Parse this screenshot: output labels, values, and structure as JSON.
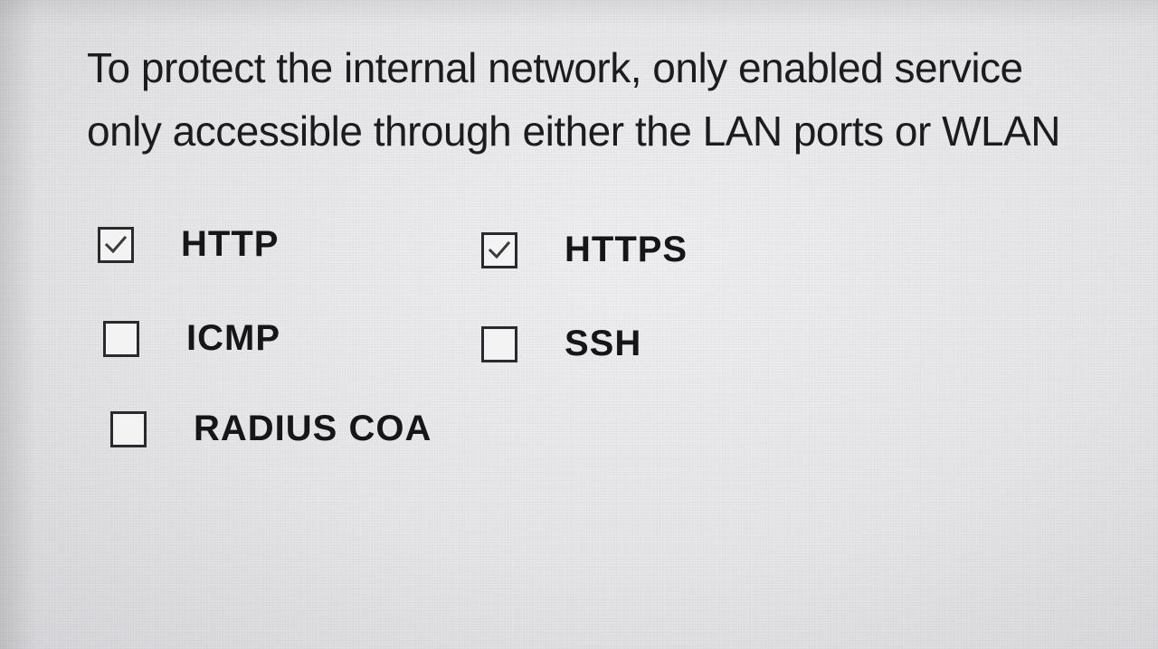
{
  "description": {
    "line1": "To protect the internal network, only enabled service",
    "line2": "only accessible through either the LAN ports or WLAN"
  },
  "services": [
    {
      "id": "http",
      "label": "HTTP",
      "checked": true
    },
    {
      "id": "https",
      "label": "HTTPS",
      "checked": true
    },
    {
      "id": "icmp",
      "label": "ICMP",
      "checked": false
    },
    {
      "id": "ssh",
      "label": "SSH",
      "checked": false
    },
    {
      "id": "radius",
      "label": "RADIUS COA",
      "checked": false
    }
  ],
  "icons": {
    "checked": "checkmark-icon"
  }
}
